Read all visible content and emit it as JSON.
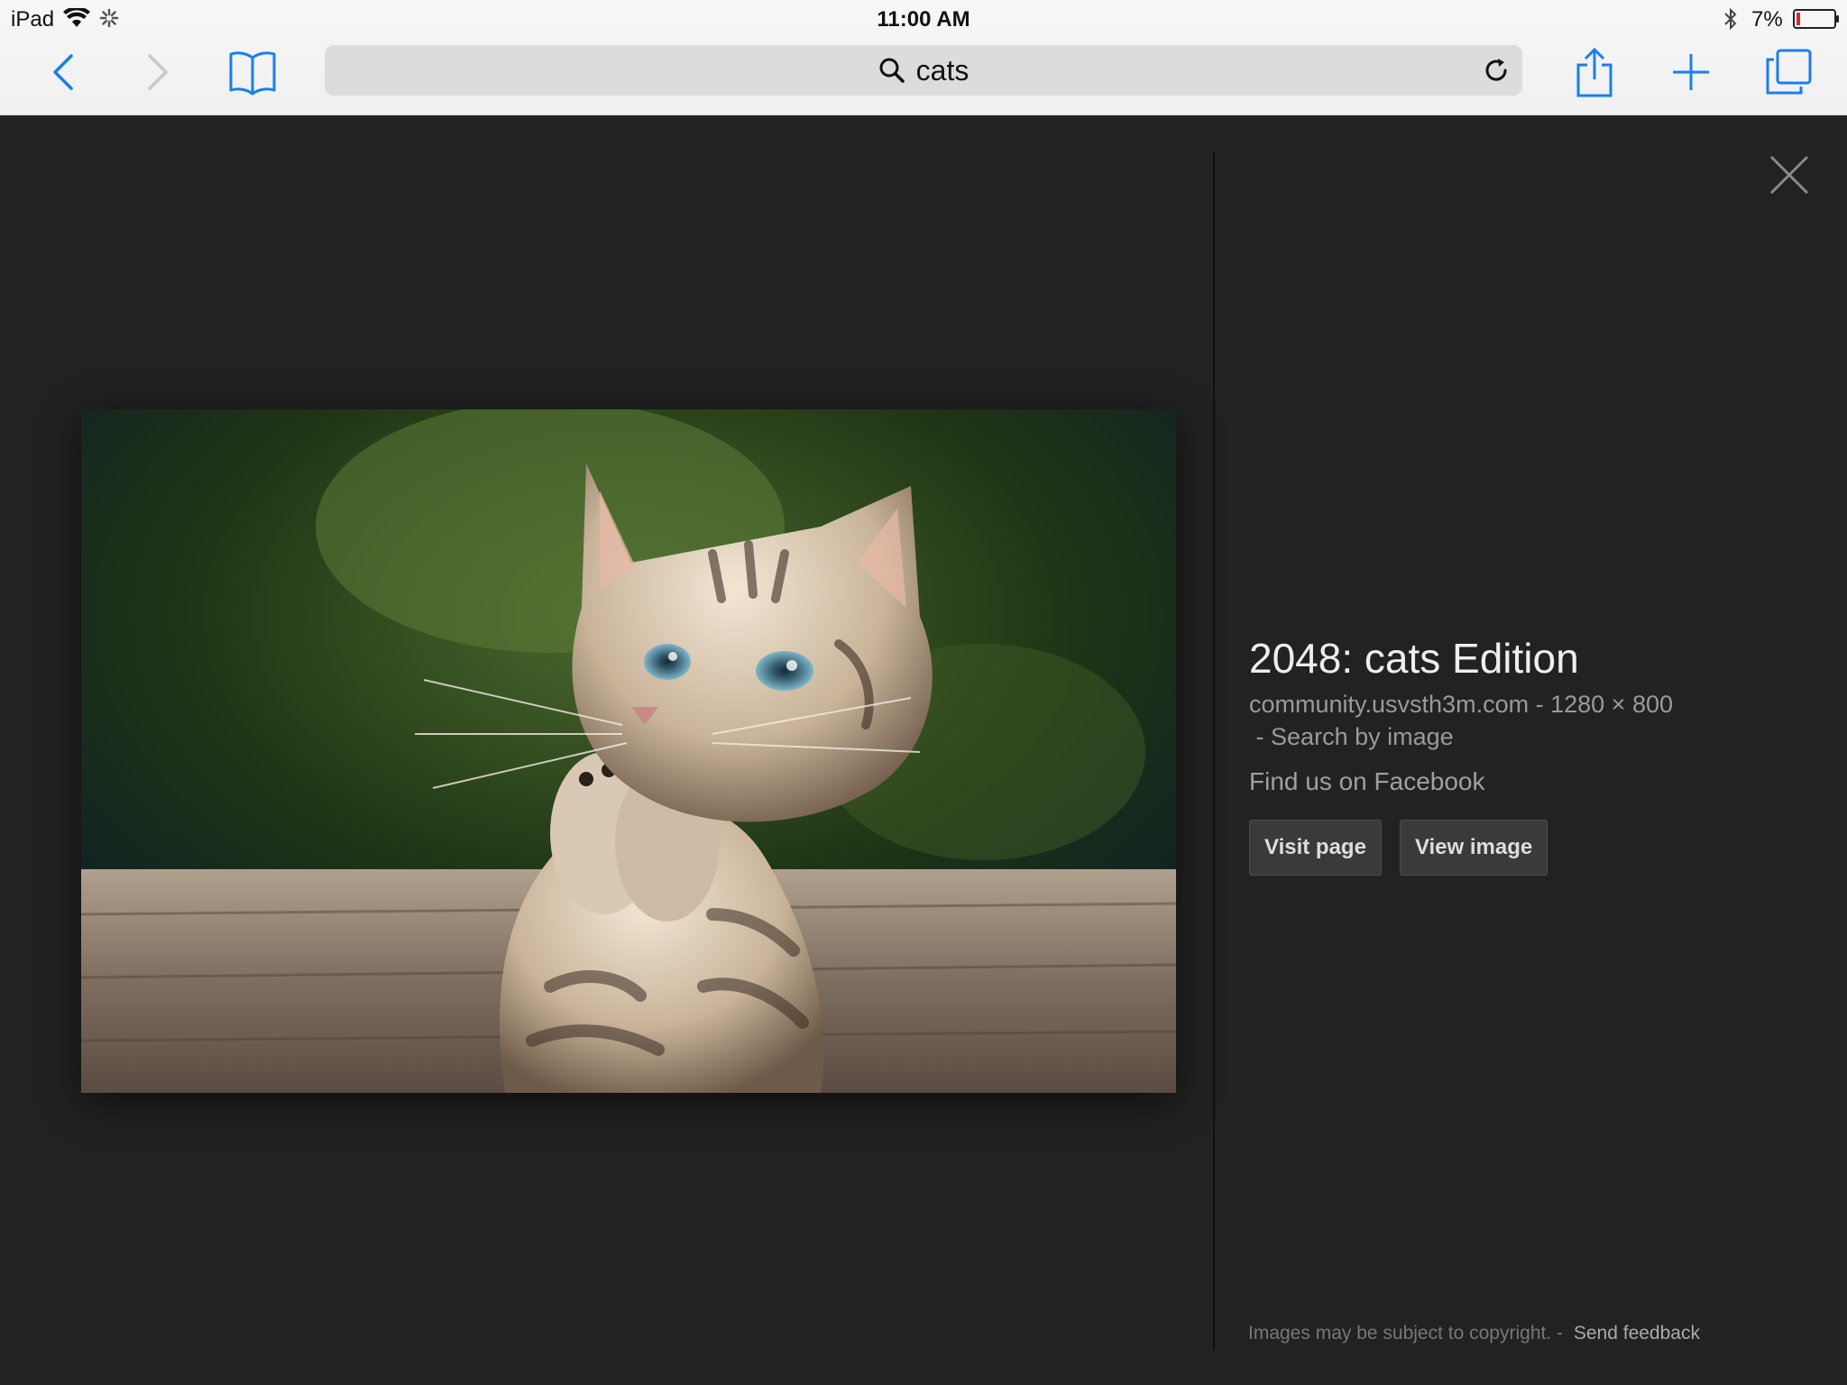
{
  "status_bar": {
    "device": "iPad",
    "time": "11:00 AM",
    "battery_percent": "7%"
  },
  "toolbar": {
    "back_icon": "chevron-left-icon",
    "forward_icon": "chevron-right-icon",
    "bookmarks_icon": "book-icon",
    "share_icon": "share-icon",
    "new_tab_icon": "plus-icon",
    "tabs_icon": "tabs-icon",
    "accent": "#1a7ef0"
  },
  "address_bar": {
    "query": "cats"
  },
  "result": {
    "title": "2048: cats Edition",
    "source": "community.usvsth3m.com",
    "separator": "-",
    "dimensions": "1280 × 800",
    "search_by_image": "Search by image",
    "extra_link": "Find us on Facebook",
    "visit_button": "Visit page",
    "view_button": "View image"
  },
  "footer": {
    "copyright": "Images may be subject to copyright.",
    "separator": "-",
    "feedback": "Send feedback"
  }
}
